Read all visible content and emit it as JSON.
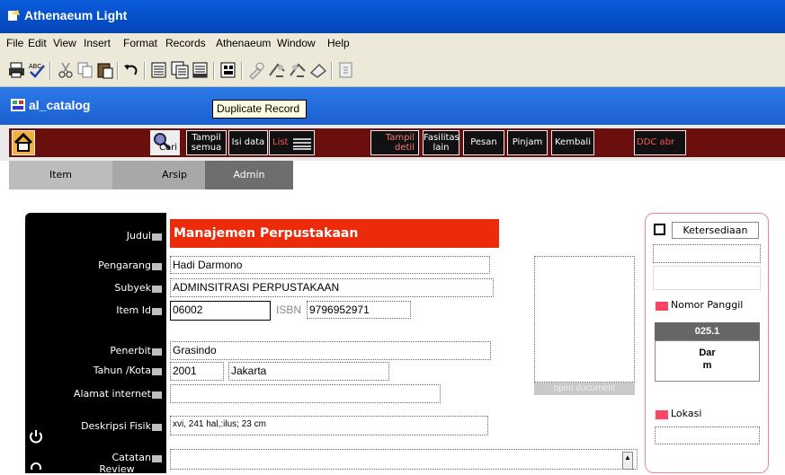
{
  "window": {
    "title": "Athenaeum Light"
  },
  "menu": [
    "File",
    "Edit",
    "View",
    "Insert",
    "Format",
    "Records",
    "Athenaeum",
    "Window",
    "Help"
  ],
  "document": {
    "title": "al_catalog",
    "tooltip": "Duplicate Record"
  },
  "nav": {
    "cari": "Cari",
    "tampil_semua_1": "Tampil",
    "tampil_semua_2": "semua",
    "isi_data": "Isi data",
    "list": "List",
    "tampil_detil_1": "Tampil",
    "tampil_detil_2": "detil",
    "fasilitas_1": "Fasilitas",
    "fasilitas_2": "lain",
    "pesan": "Pesan",
    "pinjam": "Pinjam",
    "kembali": "Kembali",
    "ddc": "DDC abr"
  },
  "tabs": [
    "Item",
    "Arsip",
    "Admin"
  ],
  "labels": {
    "judul": "Judul",
    "pengarang": "Pengarang",
    "subyek": "Subyek",
    "item_id": "Item Id",
    "penerbit": "Penerbit",
    "tahun_kota": "Tahun /Kota",
    "alamat": "Alamat internet",
    "deskripsi": "Deskripsi Fisik",
    "catatan": "Catatan",
    "catatan_2": "Review",
    "isbn": "ISBN"
  },
  "record": {
    "judul": "Manajemen Perpustakaan",
    "pengarang": "Hadi Darmono",
    "subyek": "ADMINSITRASI PERPUSTAKAAN",
    "item_id": "06002",
    "isbn": "9796952971",
    "penerbit": "Grasindo",
    "tahun": "2001",
    "kota": "Jakarta",
    "alamat": "",
    "deskripsi": "xvi, 241 hal,:ilus; 23 cm",
    "catatan": ""
  },
  "open_document": "open document",
  "side": {
    "ketersediaan": "Ketersediaan",
    "nomor_panggil_label": "Nomor Panggil",
    "nomor_panggil": "025.1",
    "call_line1": "Dar",
    "call_line2": "m",
    "lokasi": "Lokasi"
  },
  "colors": {
    "title_blue": "#0a5cdc",
    "nav_strip": "#6b0e0e",
    "judul_bg": "#ec2b0a",
    "tab_admin": "#6e6e6e",
    "tab_active": "#bcbcbc"
  }
}
